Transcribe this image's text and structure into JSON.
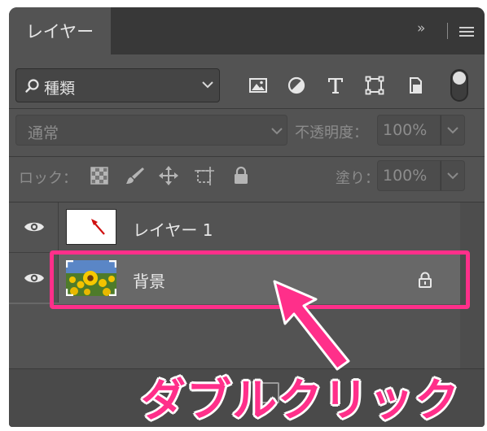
{
  "tabs": {
    "active": "レイヤー",
    "expand_glyph": "»"
  },
  "filter": {
    "kind_label": "種類"
  },
  "blend": {
    "mode": "通常",
    "opacity_label": "不透明度：",
    "opacity_value": "100%"
  },
  "lock": {
    "label": "ロック：",
    "fill_label": "塗り：",
    "fill_value": "100%"
  },
  "layers": [
    {
      "name": "レイヤー 1",
      "visible": true,
      "selected": false
    },
    {
      "name": "背景",
      "visible": true,
      "selected": true,
      "locked": true
    }
  ],
  "annotation": {
    "callout": "ダブルクリック",
    "color": "#ff2f8a"
  }
}
